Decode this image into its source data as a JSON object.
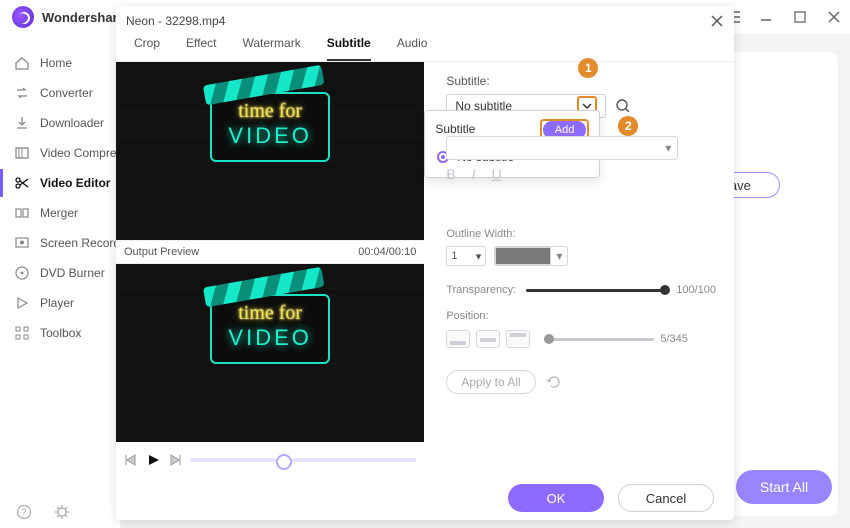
{
  "app": {
    "product_name": "Wondershare"
  },
  "titlebar": {},
  "sidebar": {
    "items": [
      {
        "label": "Home"
      },
      {
        "label": "Converter"
      },
      {
        "label": "Downloader"
      },
      {
        "label": "Video Compress"
      },
      {
        "label": "Video Editor"
      },
      {
        "label": "Merger"
      },
      {
        "label": "Screen Recorde"
      },
      {
        "label": "DVD Burner"
      },
      {
        "label": "Player"
      },
      {
        "label": "Toolbox"
      }
    ]
  },
  "main": {
    "save_label": "Save",
    "start_all_label": "Start All"
  },
  "dialog": {
    "title": "Neon - 32298.mp4",
    "tabs": [
      "Crop",
      "Effect",
      "Watermark",
      "Subtitle",
      "Audio"
    ],
    "active_tab": "Subtitle",
    "preview": {
      "neon_line1": "time for",
      "neon_line2": "VIDEO",
      "output_label": "Output Preview",
      "time": "00:04/00:10"
    },
    "subtitle_panel": {
      "label": "Subtitle:",
      "selected": "No subtitle",
      "dropdown": {
        "heading": "Subtitle",
        "add_label": "Add",
        "option": "No subtitle"
      },
      "hints": {
        "one": "1",
        "two": "2"
      },
      "outline_label": "Outline Width:",
      "outline_value": "1",
      "transparency_label": "Transparency:",
      "transparency_value": "100/100",
      "position_label": "Position:",
      "position_value": "5/345",
      "apply_label": "Apply to All"
    },
    "footer": {
      "ok": "OK",
      "cancel": "Cancel"
    }
  }
}
